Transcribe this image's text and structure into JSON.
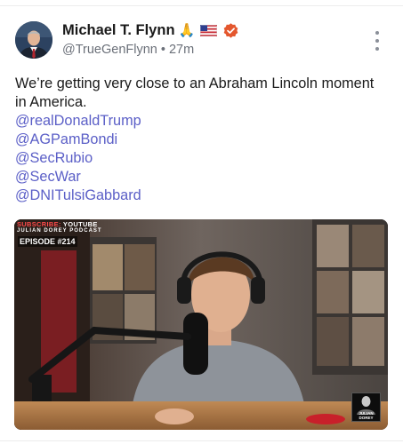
{
  "post": {
    "author": {
      "display_name": "Michael T. Flynn",
      "emojis": [
        "🙏",
        "🇺🇸"
      ],
      "handle": "@TrueGenFlynn",
      "time_ago": "27m",
      "verified": true
    },
    "text": "We’re getting very close to an Abraham Lincoln moment in America.",
    "mentions": [
      "@realDonaldTrump",
      "@AGPamBondi",
      "@SecRubio",
      "@SecWar",
      "@DNITulsiGabbard"
    ],
    "menu_icon": "more-vertical-icon",
    "media": {
      "type": "video-thumbnail",
      "overlay": {
        "subscribe_text": "SUBSCRIBE:",
        "youtube_text": "YOUTUBE",
        "podcast_text": "JULIAN DOREY PODCAST",
        "episode_text": "EPISODE #214",
        "logo_text": "JULIAN DOREY"
      }
    }
  },
  "colors": {
    "link": "#5b5fc7",
    "verified": "#e4572e",
    "handle": "#6b7079"
  }
}
